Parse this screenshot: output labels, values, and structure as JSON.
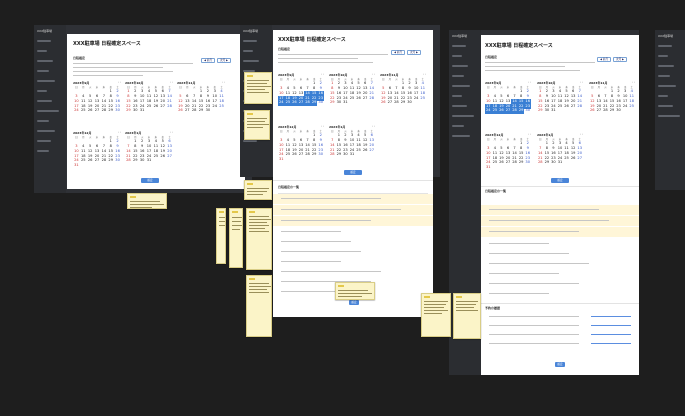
{
  "app_title": "XXX駐車場 日程確定スペース",
  "sidebar_title": "XXX駐車場",
  "frame1_title": "XXX駐車場 日程確定スペース",
  "frame2_title": "XXX駐車場 日程確定スペース",
  "frame3_title": "XXX駐車場 日程確定スペース",
  "section_title": "日程確定",
  "buttons": {
    "prev": "◀ 前月",
    "next": "次月 ▶",
    "confirm": "確定"
  },
  "calendars": {
    "f1": [
      {
        "label": "2023年9月"
      },
      {
        "label": "2023年10月"
      },
      {
        "label": "2023年11月"
      },
      {
        "label": "2023年12月"
      },
      {
        "label": "2024年1月"
      }
    ],
    "f2": [
      {
        "label": "2023年9月"
      },
      {
        "label": "2023年10月"
      },
      {
        "label": "2023年11月"
      },
      {
        "label": "2023年12月"
      },
      {
        "label": "2024年1月"
      }
    ],
    "f3": [
      {
        "label": "2023年9月"
      },
      {
        "label": "2023年10月"
      },
      {
        "label": "2023年11月"
      },
      {
        "label": "2023年12月"
      },
      {
        "label": "2024年1月"
      }
    ]
  },
  "weekdays": [
    "日",
    "月",
    "火",
    "水",
    "木",
    "金",
    "土"
  ],
  "table_heading": "日程確定の一覧",
  "history_heading": "予約の履歴"
}
